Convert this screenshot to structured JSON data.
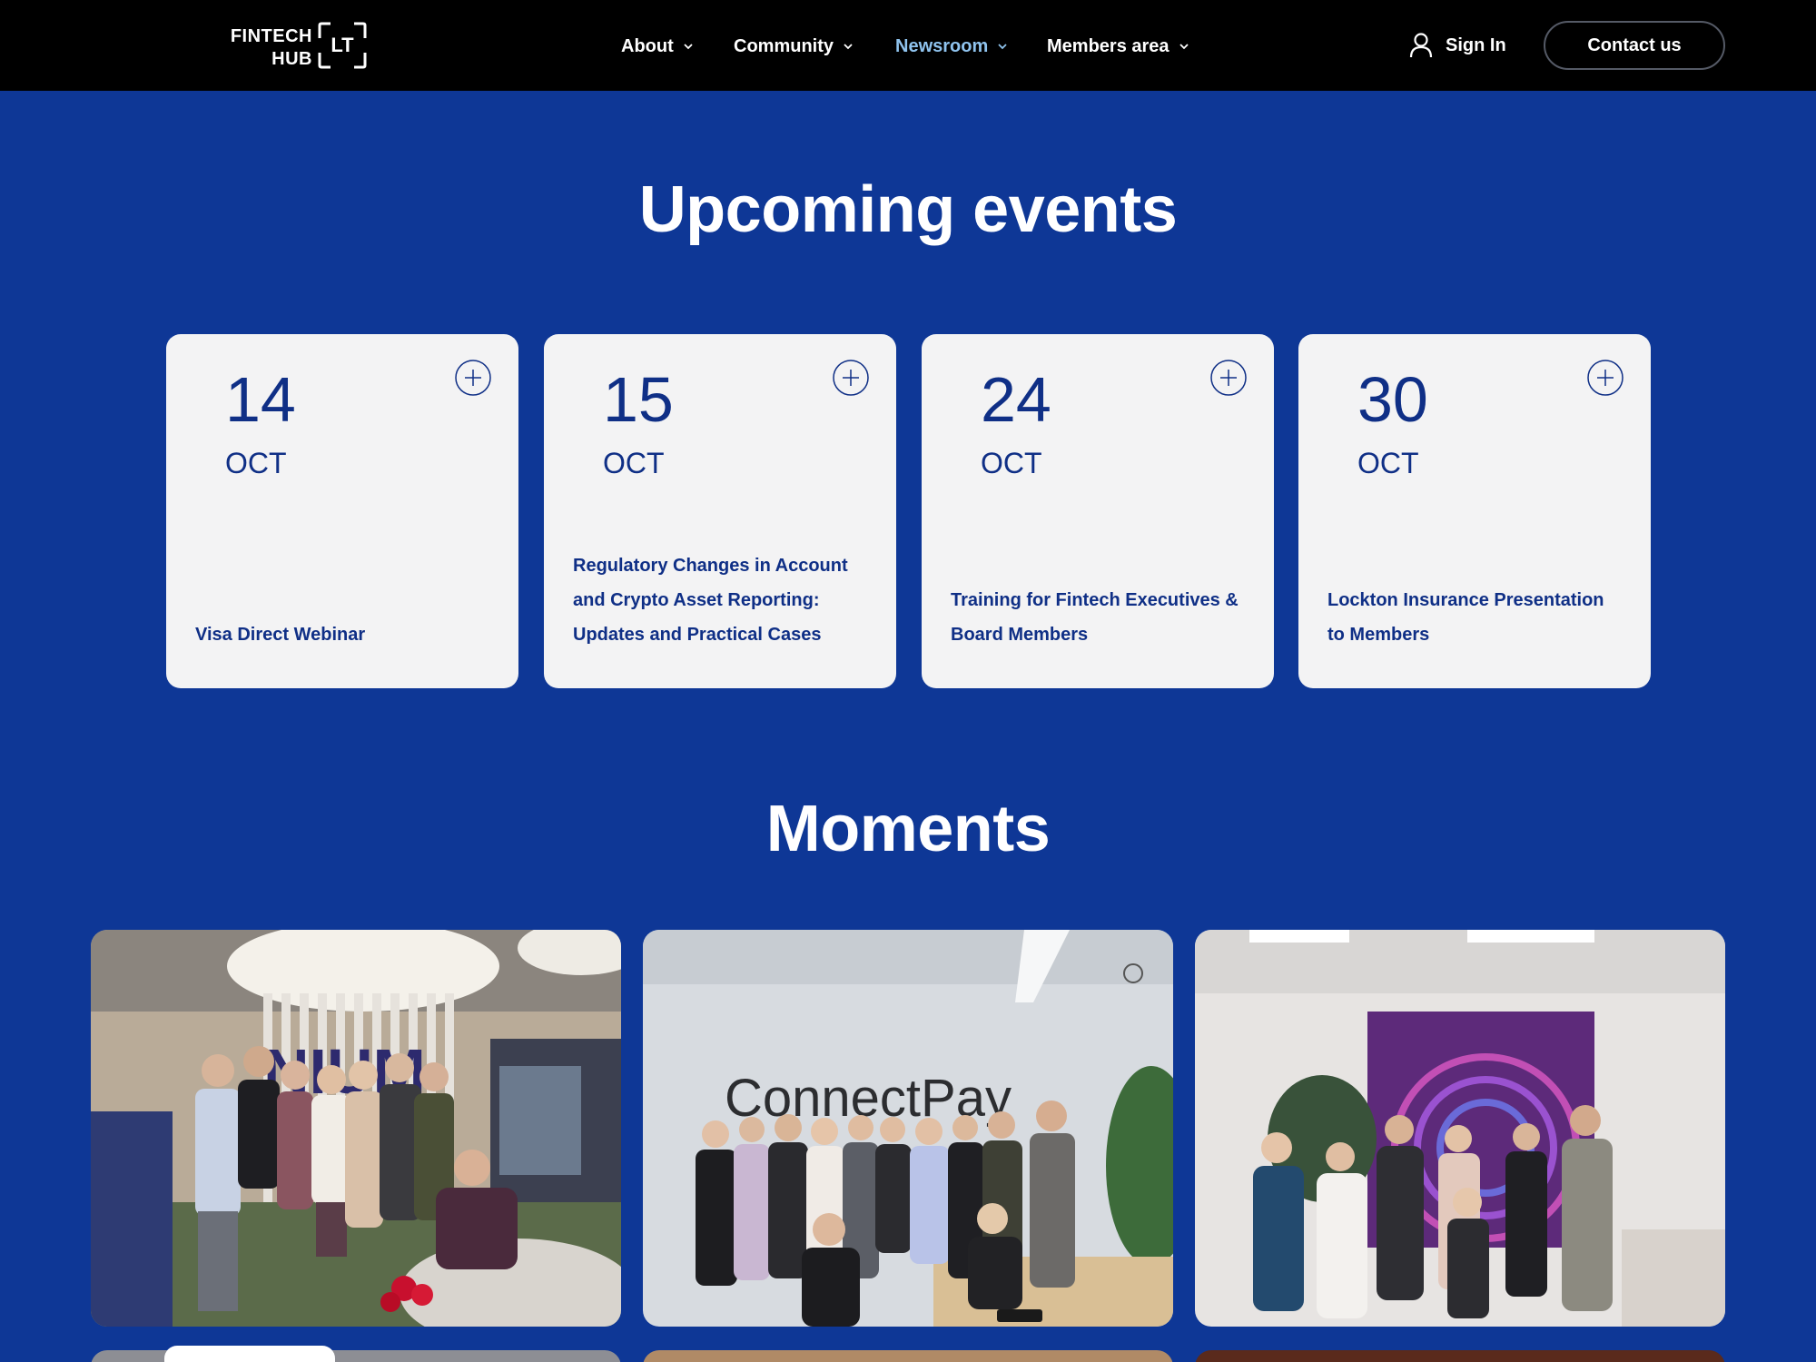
{
  "header": {
    "logo": {
      "line1": "FINTECH",
      "line2": "HUB",
      "mark": "LT"
    },
    "nav": [
      {
        "label": "About",
        "active": false
      },
      {
        "label": "Community",
        "active": false
      },
      {
        "label": "Newsroom",
        "active": true
      },
      {
        "label": "Members area",
        "active": false
      }
    ],
    "sign_in": "Sign In",
    "contact": "Contact us"
  },
  "events": {
    "title": "Upcoming events",
    "items": [
      {
        "day": "14",
        "month": "OCT",
        "title": "Visa Direct Webinar"
      },
      {
        "day": "15",
        "month": "OCT",
        "title": "Regulatory Changes in Account and Crypto Asset Reporting: Updates and Practical Cases"
      },
      {
        "day": "24",
        "month": "OCT",
        "title": "Training for Fintech Executives & Board Members"
      },
      {
        "day": "30",
        "month": "OCT",
        "title": "Lockton Insurance Presentation to Members"
      }
    ]
  },
  "moments": {
    "title": "Moments",
    "photos": [
      {
        "sign": "NIUM"
      },
      {
        "sign": "ConnectPay"
      },
      {
        "sign": ""
      }
    ]
  },
  "colors": {
    "background": "#0e3796",
    "header": "#000000",
    "card": "#f3f3f4",
    "card_text": "#0f2f86",
    "nav_active": "#8fc3ee"
  }
}
